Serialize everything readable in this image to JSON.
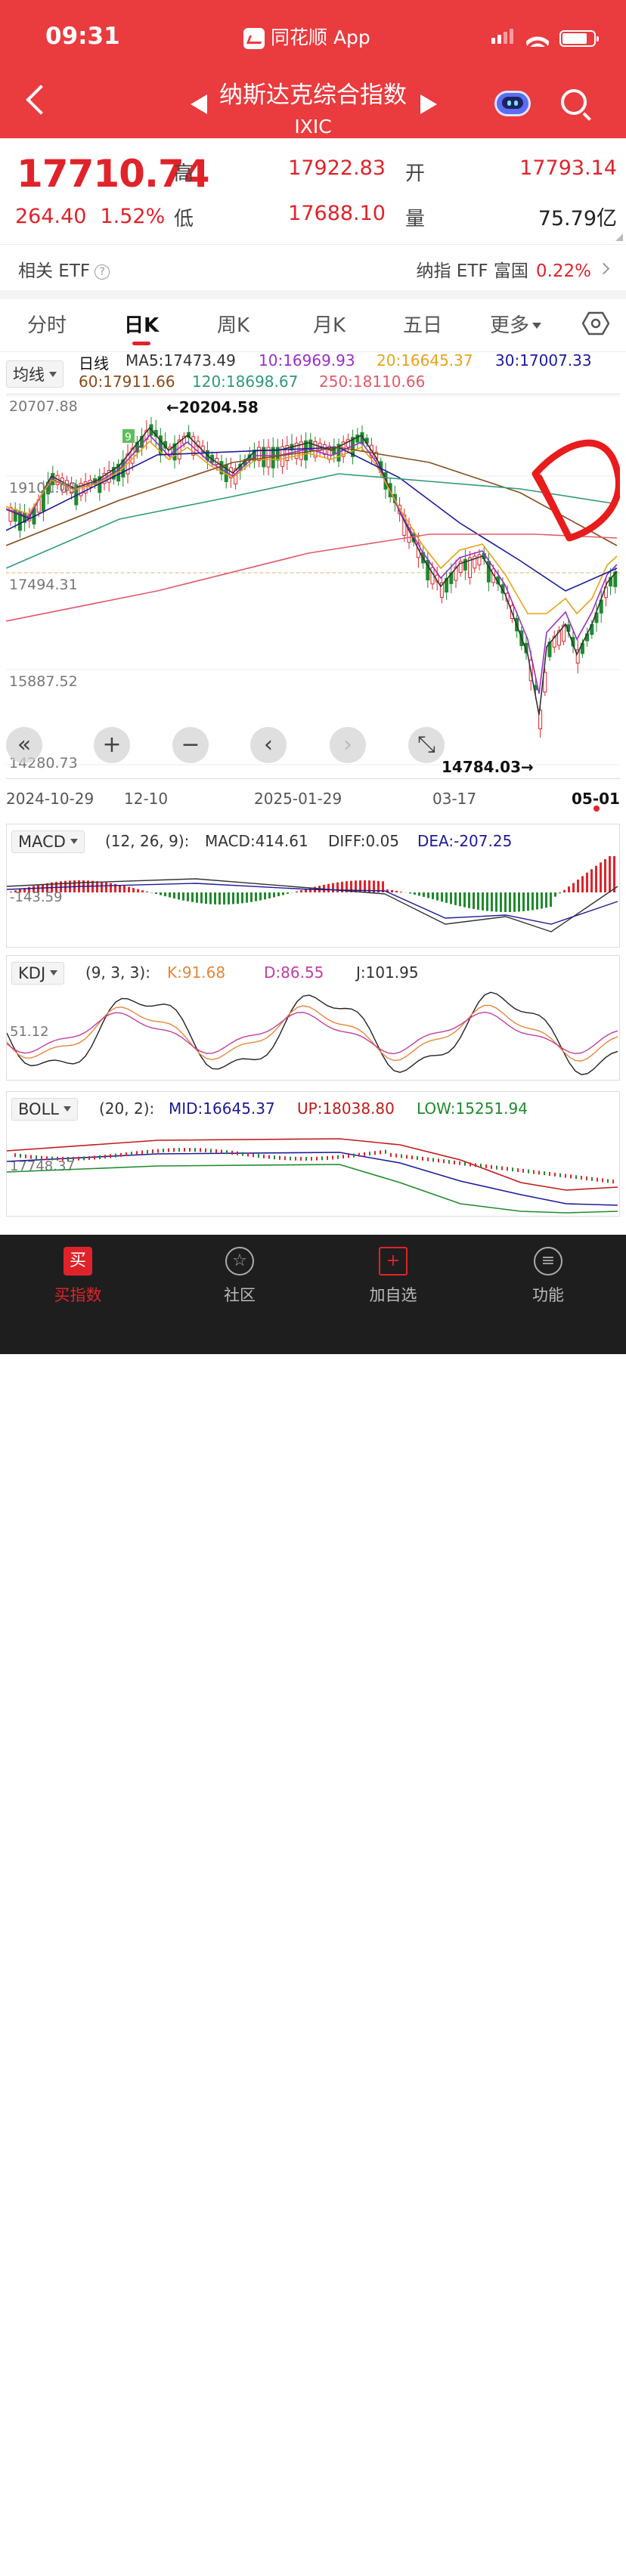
{
  "status": {
    "time": "09:31",
    "app_name": "同花顺 App"
  },
  "header": {
    "title": "纳斯达克综合指数",
    "code": "IXIC"
  },
  "quote": {
    "price": "17710.74",
    "change": "264.40",
    "change_pct": "1.52%",
    "high_label": "高",
    "high": "17922.83",
    "low_label": "低",
    "low": "17688.10",
    "open_label": "开",
    "open": "17793.14",
    "volume_label": "量",
    "volume": "75.79亿"
  },
  "etf": {
    "label": "相关 ETF",
    "help": "?",
    "name": "纳指 ETF 富国",
    "pct": "0.22%"
  },
  "tabs": [
    "分时",
    "日K",
    "周K",
    "月K",
    "五日",
    "更多"
  ],
  "ma": {
    "selector": "均线",
    "period_label": "日线",
    "ma5": "MA5:17473.49",
    "ma10": "10:16969.93",
    "ma20": "20:16645.37",
    "ma30": "30:17007.33",
    "ma60": "60:17911.66",
    "ma120": "120:18698.67",
    "ma250": "250:18110.66"
  },
  "colors": {
    "ma5": "#333333",
    "ma10": "#9b2fc8",
    "ma20": "#e8a317",
    "ma30": "#1b1b9a",
    "ma60": "#8a4a1a",
    "ma120": "#2e9a7a",
    "ma250": "#e05a6a",
    "up": "#e0232a",
    "down": "#1f8a2e"
  },
  "chart": {
    "y_labels": [
      "20707.88",
      "19101.09",
      "17494.31",
      "15887.52",
      "14280.73"
    ],
    "high_marker": "←20204.58",
    "low_marker": "14784.03→",
    "dates": [
      "2024-10-29",
      "12-10",
      "2025-01-29",
      "03-17",
      "05-01"
    ],
    "controls": [
      "«",
      "+",
      "−",
      "‹",
      "›",
      "⤡"
    ],
    "badge": "9"
  },
  "macd": {
    "selector": "MACD",
    "params": "(12, 26, 9):",
    "macd": "MACD:414.61",
    "diff": "DIFF:0.05",
    "dea": "DEA:-207.25",
    "axis": "-143.59"
  },
  "kdj": {
    "selector": "KDJ",
    "params": "(9, 3, 3):",
    "k": "K:91.68",
    "d": "D:86.55",
    "j": "J:101.95",
    "axis": "51.12"
  },
  "boll": {
    "selector": "BOLL",
    "params": "(20, 2):",
    "mid": "MID:16645.37",
    "up": "UP:18038.80",
    "low": "LOW:15251.94",
    "axis": "17748.37"
  },
  "nav": [
    {
      "label": "买指数",
      "icon": "买"
    },
    {
      "label": "社区",
      "icon": "☆"
    },
    {
      "label": "加自选",
      "icon": "+"
    },
    {
      "label": "功能",
      "icon": "≡"
    }
  ]
}
